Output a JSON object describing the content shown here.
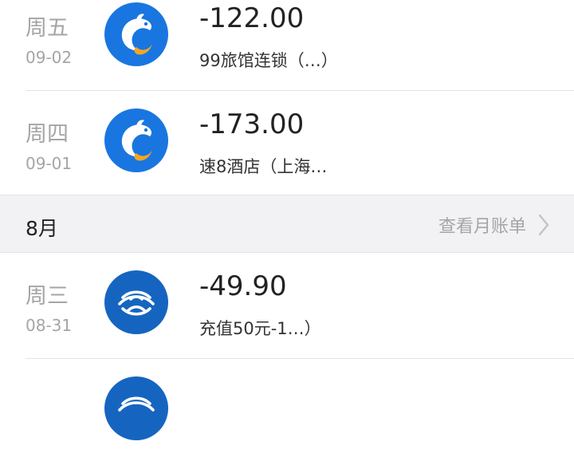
{
  "colors": {
    "ctrip_blue": "#1976e0",
    "ctrip_orange": "#f5a623",
    "cmcc_blue": "#1565c0",
    "muted_text": "#a5a5a5",
    "month_bar_bg": "#f2f2f5"
  },
  "transactions": [
    {
      "day": "周五",
      "date": "09-02",
      "amount": "-122.00",
      "desc": "99旅馆连锁（…）",
      "icon": "dolphin-icon"
    },
    {
      "day": "周四",
      "date": "09-01",
      "amount": "-173.00",
      "desc": "速8酒店（上海…",
      "icon": "dolphin-icon"
    },
    {
      "day": "周三",
      "date": "08-31",
      "amount": "-49.90",
      "desc": "充值50元-1…）",
      "icon": "china-mobile-icon"
    },
    {
      "icon": "china-mobile-icon"
    }
  ],
  "month_bar": {
    "label": "8月",
    "link_label": "查看月账单",
    "link_icon": "chevron-right-icon"
  }
}
